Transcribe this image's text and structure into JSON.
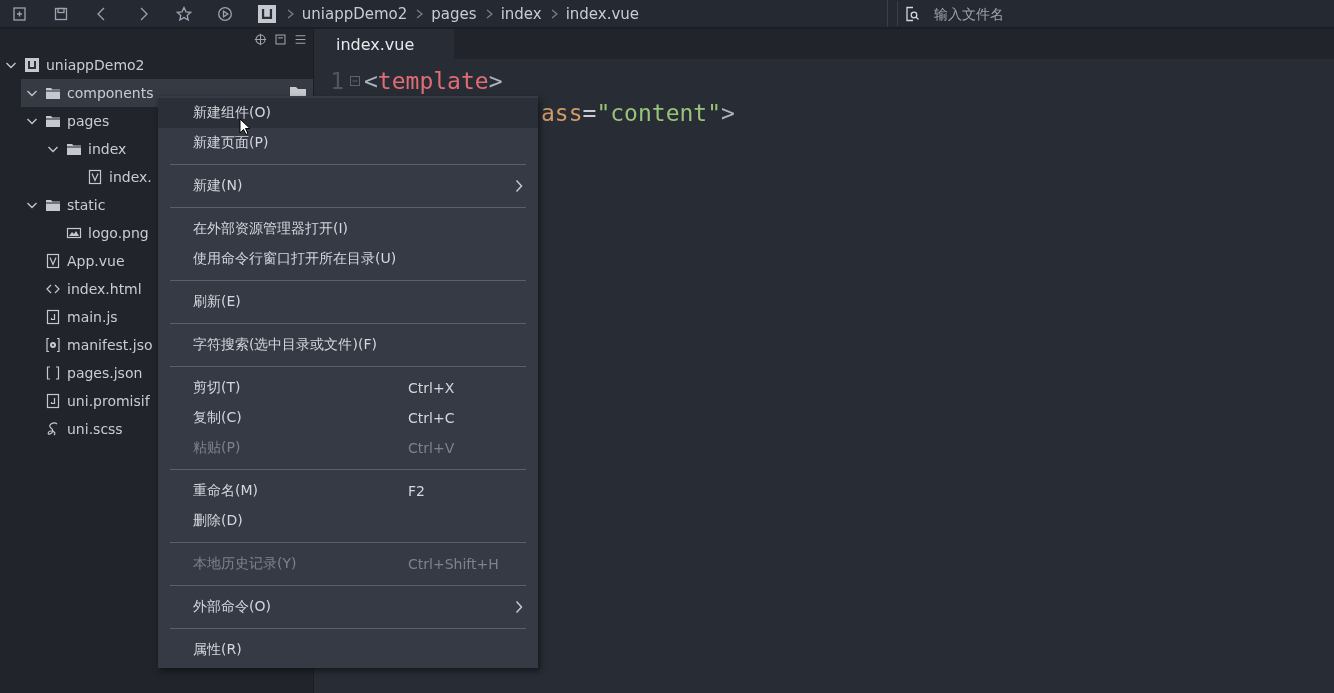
{
  "breadcrumb": [
    {
      "label": "uniappDemo2",
      "kind": "project"
    },
    {
      "label": "pages",
      "kind": "folder"
    },
    {
      "label": "index",
      "kind": "folder"
    },
    {
      "label": "index.vue",
      "kind": "file"
    }
  ],
  "search": {
    "placeholder": "输入文件名"
  },
  "sidebar": {
    "tree": [
      {
        "name": "uniappDemo2",
        "kind": "project",
        "expanded": true,
        "selected": false,
        "children": [
          {
            "name": "components",
            "kind": "folder",
            "expanded": true,
            "selected": true
          },
          {
            "name": "pages",
            "kind": "folder",
            "expanded": true,
            "selected": false,
            "children": [
              {
                "name": "index",
                "kind": "folder",
                "expanded": true,
                "selected": false,
                "children": [
                  {
                    "name": "index.",
                    "kind": "vue",
                    "selected": false
                  }
                ]
              }
            ]
          },
          {
            "name": "static",
            "kind": "folder",
            "expanded": true,
            "selected": false,
            "children": [
              {
                "name": "logo.png",
                "kind": "image",
                "selected": false
              }
            ]
          },
          {
            "name": "App.vue",
            "kind": "vue",
            "selected": false
          },
          {
            "name": "index.html",
            "kind": "html",
            "selected": false
          },
          {
            "name": "main.js",
            "kind": "js",
            "selected": false
          },
          {
            "name": "manifest.jso",
            "kind": "manifest",
            "selected": false
          },
          {
            "name": "pages.json",
            "kind": "json",
            "selected": false
          },
          {
            "name": "uni.promisif",
            "kind": "js",
            "selected": false
          },
          {
            "name": "uni.scss",
            "kind": "scss",
            "selected": false
          }
        ]
      }
    ]
  },
  "editor": {
    "tabs": [
      {
        "label": "index.vue",
        "selected": true
      }
    ],
    "lines": [
      {
        "number": "1",
        "foldable": true,
        "tokens": [
          {
            "text": "<",
            "kind": "bracket"
          },
          {
            "text": "template",
            "kind": "tag"
          },
          {
            "text": ">",
            "kind": "bracket"
          }
        ]
      },
      {
        "foldable": false,
        "tokens": [
          {
            "text": "ass",
            "kind": "attr"
          },
          {
            "text": "=",
            "kind": "punct"
          },
          {
            "text": "\"content\"",
            "kind": "string"
          },
          {
            "text": ">",
            "kind": "bracket"
          }
        ]
      }
    ]
  },
  "context_menu": {
    "items": [
      {
        "kind": "item",
        "label": "新建组件(O)",
        "selected": true,
        "disabled": false
      },
      {
        "kind": "item",
        "label": "新建页面(P)",
        "selected": false,
        "disabled": false
      },
      {
        "kind": "separator"
      },
      {
        "kind": "item",
        "label": "新建(N)",
        "selected": false,
        "disabled": false,
        "submenu": true
      },
      {
        "kind": "separator"
      },
      {
        "kind": "item",
        "label": "在外部资源管理器打开(I)",
        "selected": false,
        "disabled": false
      },
      {
        "kind": "item",
        "label": "使用命令行窗口打开所在目录(U)",
        "selected": false,
        "disabled": false
      },
      {
        "kind": "separator"
      },
      {
        "kind": "item",
        "label": "刷新(E)",
        "selected": false,
        "disabled": false
      },
      {
        "kind": "separator"
      },
      {
        "kind": "item",
        "label": "字符搜索(选中目录或文件)(F)",
        "selected": false,
        "disabled": false
      },
      {
        "kind": "separator"
      },
      {
        "kind": "item",
        "label": "剪切(T)",
        "shortcut": "Ctrl+X",
        "selected": false,
        "disabled": false
      },
      {
        "kind": "item",
        "label": "复制(C)",
        "shortcut": "Ctrl+C",
        "selected": false,
        "disabled": false
      },
      {
        "kind": "item",
        "label": "粘贴(P)",
        "shortcut": "Ctrl+V",
        "selected": false,
        "disabled": true
      },
      {
        "kind": "separator"
      },
      {
        "kind": "item",
        "label": "重命名(M)",
        "shortcut": "F2",
        "selected": false,
        "disabled": false
      },
      {
        "kind": "item",
        "label": "删除(D)",
        "selected": false,
        "disabled": false
      },
      {
        "kind": "separator"
      },
      {
        "kind": "item",
        "label": "本地历史记录(Y)",
        "shortcut": "Ctrl+Shift+H",
        "selected": false,
        "disabled": true
      },
      {
        "kind": "separator"
      },
      {
        "kind": "item",
        "label": "外部命令(O)",
        "selected": false,
        "disabled": false,
        "submenu": true
      },
      {
        "kind": "separator"
      },
      {
        "kind": "item",
        "label": "属性(R)",
        "selected": false,
        "disabled": false
      }
    ]
  }
}
